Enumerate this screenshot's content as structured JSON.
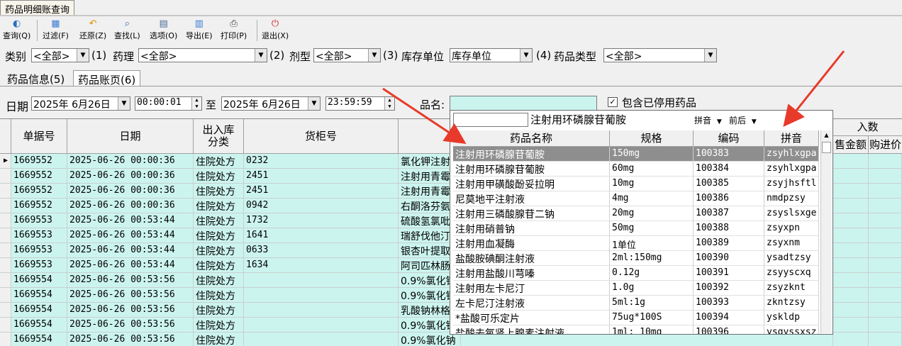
{
  "window": {
    "tab_title": "药品明细账查询"
  },
  "toolbar": [
    {
      "label": "查询(Q)",
      "icon": "query-icon",
      "glyph": "◐",
      "color": "#2a6fc0"
    },
    {
      "label": "过滤(F)",
      "icon": "filter-icon",
      "glyph": "▦",
      "color": "#3a7bd5"
    },
    {
      "label": "还原(Z)",
      "icon": "restore-icon",
      "glyph": "↶",
      "color": "#e09000"
    },
    {
      "label": "查找(L)",
      "icon": "find-icon",
      "glyph": "⌕",
      "color": "#3366aa"
    },
    {
      "label": "选项(O)",
      "icon": "options-icon",
      "glyph": "▤",
      "color": "#4a6a9a"
    },
    {
      "label": "导出(E)",
      "icon": "export-icon",
      "glyph": "▥",
      "color": "#3a7bd5"
    },
    {
      "label": "打印(P)",
      "icon": "print-icon",
      "glyph": "⎙",
      "color": "#444444"
    },
    {
      "label": "退出(X)",
      "icon": "exit-icon",
      "glyph": "⏻",
      "color": "#d02020"
    }
  ],
  "filters": {
    "category_label": "类别",
    "category_value": "<全部>",
    "hint1": "(1)",
    "pharmacology_label": "药理",
    "pharmacology_value": "<全部>",
    "hint2": "(2)",
    "dosage_label": "剂型",
    "dosage_value": "<全部>",
    "hint3": "(3)",
    "stock_unit_label": "库存单位",
    "stock_unit_value": "库存单位",
    "hint4": "(4)",
    "drug_type_label": "药品类型",
    "drug_type_value": "<全部>"
  },
  "tabs": {
    "info": "药品信息(5)",
    "ledger": "药品账页(6)"
  },
  "date_row": {
    "date_label": "日期",
    "start_date": "2025年 6月26日",
    "start_time": "00:00:01",
    "to_label": "至",
    "end_date": "2025年 6月26日",
    "end_time": "23:59:59",
    "drug_name_label": "品名:",
    "include_disabled_label": "包含已停用药品",
    "include_disabled_checked": "✓"
  },
  "grid": {
    "headers": {
      "doc_no": "单据号",
      "date": "日期",
      "inout_type": "出入库\n分类",
      "cabinet": "货柜号",
      "drug": "药",
      "inbound": "入数",
      "sale_amount": "售金额",
      "purchase": "购进价"
    },
    "rows": [
      {
        "doc": "1669552",
        "date": "2025-06-26 00:00:36",
        "type": "住院处方",
        "cab": "0232",
        "drug": "氯化钾注射"
      },
      {
        "doc": "1669552",
        "date": "2025-06-26 00:00:36",
        "type": "住院处方",
        "cab": "2451",
        "drug": "注射用青霉"
      },
      {
        "doc": "1669552",
        "date": "2025-06-26 00:00:36",
        "type": "住院处方",
        "cab": "2451",
        "drug": "注射用青霉"
      },
      {
        "doc": "1669552",
        "date": "2025-06-26 00:00:36",
        "type": "住院处方",
        "cab": "0942",
        "drug": "右酮洛芬氨"
      },
      {
        "doc": "1669553",
        "date": "2025-06-26 00:53:44",
        "type": "住院处方",
        "cab": "1732",
        "drug": "硫酸氢氯吡"
      },
      {
        "doc": "1669553",
        "date": "2025-06-26 00:53:44",
        "type": "住院处方",
        "cab": "1641",
        "drug": "瑞舒伐他汀"
      },
      {
        "doc": "1669553",
        "date": "2025-06-26 00:53:44",
        "type": "住院处方",
        "cab": "0633",
        "drug": "银杏叶提取"
      },
      {
        "doc": "1669553",
        "date": "2025-06-26 00:53:44",
        "type": "住院处方",
        "cab": "1634",
        "drug": "阿司匹林肠"
      },
      {
        "doc": "1669554",
        "date": "2025-06-26 00:53:56",
        "type": "住院处方",
        "cab": "",
        "drug": "0.9%氯化钠"
      },
      {
        "doc": "1669554",
        "date": "2025-06-26 00:53:56",
        "type": "住院处方",
        "cab": "",
        "drug": "0.9%氯化钠"
      },
      {
        "doc": "1669554",
        "date": "2025-06-26 00:53:56",
        "type": "住院处方",
        "cab": "",
        "drug": "乳酸钠林格"
      },
      {
        "doc": "1669554",
        "date": "2025-06-26 00:53:56",
        "type": "住院处方",
        "cab": "",
        "drug": "0.9%氯化钠"
      },
      {
        "doc": "1669554",
        "date": "2025-06-26 00:53:56",
        "type": "住院处方",
        "cab": "",
        "drug": "0.9%氯化钠"
      },
      {
        "doc": "1669554",
        "date": "2025-06-26 00:53:56",
        "type": "住院处方",
        "cab": "",
        "drug": "乳酸钠林格"
      }
    ]
  },
  "popup": {
    "search_value": "",
    "selected_name": "注射用环磷腺苷葡胺",
    "sort_pinyin": "拼音",
    "sort_order": "前后",
    "headers": {
      "name": "药品名称",
      "spec": "规格",
      "code": "编码",
      "pinyin": "拼音"
    },
    "rows": [
      {
        "name": "注射用环磷腺苷葡胺",
        "spec": "150mg",
        "code": "100383",
        "py": "zsyhlxgpa"
      },
      {
        "name": "注射用环磷腺苷葡胺",
        "spec": "60mg",
        "code": "100384",
        "py": "zsyhlxgpa"
      },
      {
        "name": "注射用甲磺酸酚妥拉明",
        "spec": "10mg",
        "code": "100385",
        "py": "zsyjhsftl"
      },
      {
        "name": "尼莫地平注射液",
        "spec": "4mg",
        "code": "100386",
        "py": "nmdpzsy"
      },
      {
        "name": "注射用三磷酸腺苷二钠",
        "spec": "20mg",
        "code": "100387",
        "py": "zsyslsxge"
      },
      {
        "name": "注射用硝普钠",
        "spec": "50mg",
        "code": "100388",
        "py": "zsyxpn"
      },
      {
        "name": "注射用血凝酶",
        "spec": "1单位",
        "code": "100389",
        "py": "zsyxnm"
      },
      {
        "name": "盐酸胺碘酮注射液",
        "spec": "2ml:150mg",
        "code": "100390",
        "py": "ysadtzsy"
      },
      {
        "name": "注射用盐酸川芎嗪",
        "spec": "0.12g",
        "code": "100391",
        "py": "zsyyscxq"
      },
      {
        "name": "注射用左卡尼汀",
        "spec": "1.0g",
        "code": "100392",
        "py": "zsyzknt"
      },
      {
        "name": "左卡尼汀注射液",
        "spec": "5ml:1g",
        "code": "100393",
        "py": "zkntzsy"
      },
      {
        "name": "*盐酸可乐定片",
        "spec": "75ug*100S",
        "code": "100394",
        "py": "yskldp"
      },
      {
        "name": "盐酸去氧肾上腺素注射液",
        "spec": "1ml: 10mg",
        "code": "100396",
        "py": "ysqyssxsz"
      }
    ]
  },
  "colors": {
    "grid_cell": "#ccf4ee",
    "selected_row": "#8e8e8e",
    "annotation_arrow": "#e83a2a"
  }
}
